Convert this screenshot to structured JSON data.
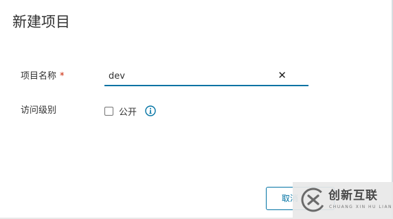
{
  "dialog": {
    "title": "新建项目"
  },
  "form": {
    "project_name": {
      "label": "项目名称",
      "required_mark": "*",
      "value": "dev"
    },
    "access_level": {
      "label": "访问级别",
      "public_checkbox_label": "公开",
      "public_checked": false
    }
  },
  "footer": {
    "cancel_label": "取消"
  },
  "watermark": {
    "title": "创新互联",
    "subtitle": "CHUANG XIN HU LIAN"
  },
  "colors": {
    "accent": "#0072a3",
    "required": "#c92100",
    "text": "#313131"
  },
  "icons": [
    "clear-icon",
    "info-icon",
    "chuangxin-logo-icon"
  ]
}
